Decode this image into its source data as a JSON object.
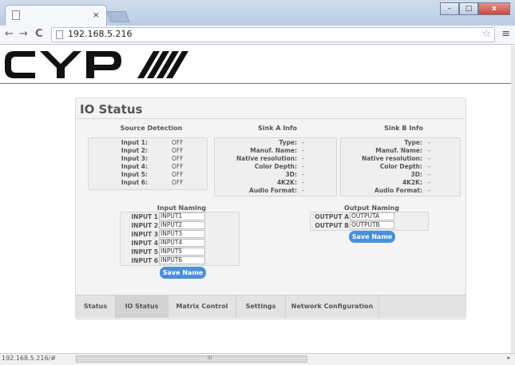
{
  "browser": {
    "tab_close": "×",
    "url": "192.168.5.216",
    "nav_back": "←",
    "nav_forward": "→",
    "nav_reload": "C",
    "star": "☆",
    "menu": "≡",
    "win_min": "–",
    "win_max": "□",
    "win_close": "x",
    "status_url": "192.168.5.216/#",
    "scroll_grip": "III",
    "scroll_right": "▸"
  },
  "colors": {
    "accent_button": "#4a90d9",
    "header_line": "#5a7bb5"
  },
  "icons": {
    "back": "back-arrow-icon",
    "forward": "forward-arrow-icon",
    "reload": "reload-icon",
    "page": "page-icon",
    "star": "bookmark-star-icon",
    "menu": "hamburger-menu-icon"
  },
  "page": {
    "title": "IO Status",
    "source_detection": {
      "title": "Source Detection",
      "rows": [
        {
          "label": "Input 1:",
          "value": "OFF"
        },
        {
          "label": "Input 2:",
          "value": "OFF"
        },
        {
          "label": "Input 3:",
          "value": "OFF"
        },
        {
          "label": "Input 4:",
          "value": "OFF"
        },
        {
          "label": "Input 5:",
          "value": "OFF"
        },
        {
          "label": "Input 6:",
          "value": "OFF"
        }
      ]
    },
    "sink_a": {
      "title": "Sink A Info",
      "rows": [
        {
          "label": "Type:",
          "value": "-"
        },
        {
          "label": "Manuf. Name:",
          "value": "-"
        },
        {
          "label": "Native resolution:",
          "value": "-"
        },
        {
          "label": "Color Depth:",
          "value": "-"
        },
        {
          "label": "3D:",
          "value": "-"
        },
        {
          "label": "4K2K:",
          "value": "-"
        },
        {
          "label": "Audio Format:",
          "value": "-"
        }
      ]
    },
    "sink_b": {
      "title": "Sink B Info",
      "rows": [
        {
          "label": "Type:",
          "value": "-"
        },
        {
          "label": "Manuf. Name:",
          "value": "-"
        },
        {
          "label": "Native resolution:",
          "value": "-"
        },
        {
          "label": "Color Depth:",
          "value": "-"
        },
        {
          "label": "3D:",
          "value": "-"
        },
        {
          "label": "4K2K:",
          "value": "-"
        },
        {
          "label": "Audio Format:",
          "value": "-"
        }
      ]
    },
    "input_naming": {
      "title": "Input Naming",
      "rows": [
        {
          "label": "INPUT 1",
          "value": "INPUT1"
        },
        {
          "label": "INPUT 2",
          "value": "INPUT2"
        },
        {
          "label": "INPUT 3",
          "value": "INPUT3"
        },
        {
          "label": "INPUT 4",
          "value": "INPUT4"
        },
        {
          "label": "INPUT 5",
          "value": "INPUT5"
        },
        {
          "label": "INPUT 6",
          "value": "INPUT6"
        }
      ],
      "save_label": "Save Name"
    },
    "output_naming": {
      "title": "Output Naming",
      "rows": [
        {
          "label": "OUTPUT A",
          "value": "OUTPUTA"
        },
        {
          "label": "OUTPUT B",
          "value": "OUTPUTB"
        }
      ],
      "save_label": "Save Name"
    },
    "tabs": [
      {
        "label": "Status"
      },
      {
        "label": "IO Status"
      },
      {
        "label": "Matrix Control"
      },
      {
        "label": "Settings"
      },
      {
        "label": "Network Configuration"
      }
    ]
  }
}
